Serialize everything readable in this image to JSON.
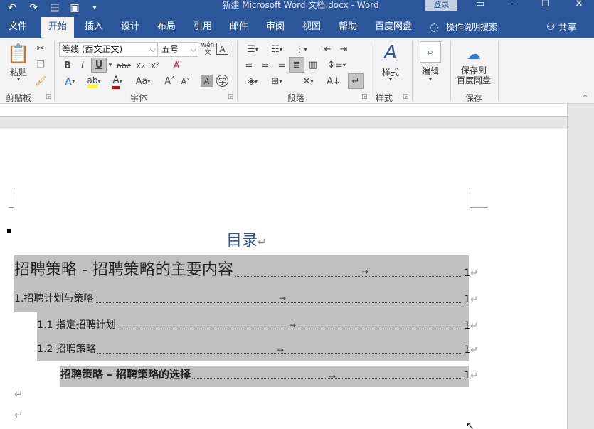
{
  "titlebar": {
    "doc_title": "新建 Microsoft Word 文档.docx  -  Word",
    "login": "登录",
    "qat": [
      "undo-icon",
      "redo-icon",
      "touch-mode-icon",
      "save-icon",
      "customize-qat-icon"
    ]
  },
  "tabs": [
    {
      "label": "文件"
    },
    {
      "label": "开始",
      "active": true
    },
    {
      "label": "插入"
    },
    {
      "label": "设计"
    },
    {
      "label": "布局"
    },
    {
      "label": "引用"
    },
    {
      "label": "邮件"
    },
    {
      "label": "审阅"
    },
    {
      "label": "视图"
    },
    {
      "label": "帮助"
    },
    {
      "label": "百度网盘"
    }
  ],
  "tell_me": "操作说明搜索",
  "share": "共享",
  "ribbon": {
    "clipboard": {
      "paste": "粘贴",
      "label": "剪贴板"
    },
    "font": {
      "font_name": "等线 (西文正文)",
      "font_size": "五号",
      "wen": "wén",
      "wen_sub": "文",
      "label": "字体"
    },
    "paragraph": {
      "label": "段落"
    },
    "styles": {
      "button": "样式",
      "label": "样式"
    },
    "editing": {
      "button": "编辑"
    },
    "save": {
      "button_line1": "保存到",
      "button_line2": "百度网盘",
      "label": "保存"
    }
  },
  "document": {
    "toc_title": "目录",
    "para_mark": "↵",
    "tab_arrow": "→",
    "entries": [
      {
        "text": "招聘策略 - 招聘策略的主要内容",
        "page": "1",
        "level": "heading"
      },
      {
        "text": "1.招聘计划与策略",
        "page": "1",
        "level": "1"
      },
      {
        "text": "1.1 指定招聘计划",
        "page": "1",
        "level": "2"
      },
      {
        "text": "1.2 招聘策略",
        "page": "1",
        "level": "2"
      },
      {
        "text": "招聘策略 – 招聘策略的选择",
        "page": "1",
        "level": "3"
      }
    ]
  },
  "colors": {
    "title_bar": "#2b579a",
    "ribbon_bg": "#f3f3f3",
    "selection": "#c0c0c0",
    "toc_title": "#2f5597"
  }
}
